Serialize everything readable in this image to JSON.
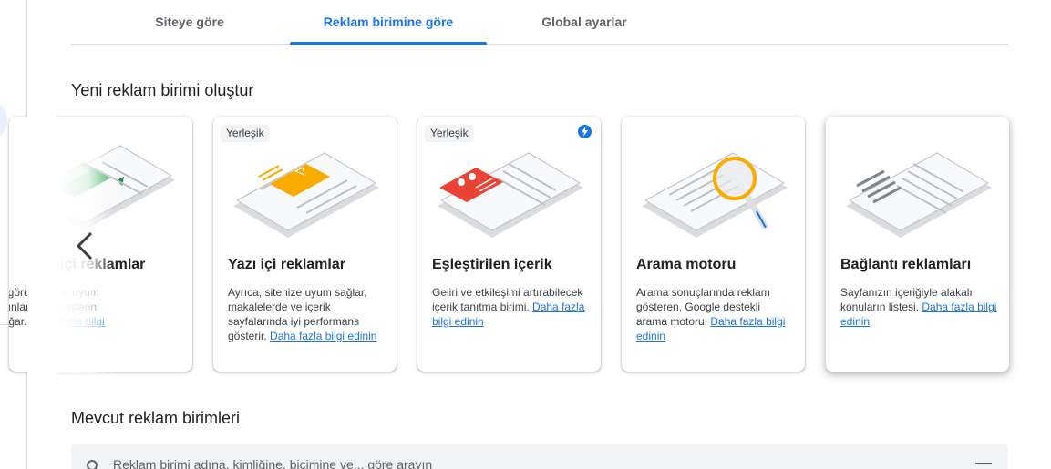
{
  "tabs": [
    {
      "label": "Siteye göre"
    },
    {
      "label": "Reklam birimine göre",
      "active": true
    },
    {
      "label": "Global ayarlar"
    }
  ],
  "section_new": "Yeni reklam birimi oluştur",
  "section_existing": "Mevcut reklam birimleri",
  "cards": [
    {
      "title": "içi reklamlar",
      "desc_lines": [
        "zin görünümüne uyum",
        "yayınların ve girişlerin",
        "a sığar."
      ],
      "link": "Daha fazla bilgi"
    },
    {
      "badge": "Yerleşik",
      "title": "Yazı içi reklamlar",
      "desc": "Ayrıca, sitenize uyum sağlar, makalelerde ve içerik sayfalarında iyi performans gösterir.",
      "link": "Daha fazla bilgi edinin"
    },
    {
      "badge": "Yerleşik",
      "title": "Eşleştirilen içerik",
      "desc": "Geliri ve etkileşimi artırabilecek içerik tanıtma birimi.",
      "link": "Daha fazla bilgi edinin",
      "icon": "lightning-icon"
    },
    {
      "title": "Arama motoru",
      "desc": "Arama sonuçlarında reklam gösteren, Google destekli arama motoru.",
      "link": "Daha fazla bilgi edinin"
    },
    {
      "title": "Bağlantı reklamları",
      "desc": "Sayfanızın içeriğiyle alakalı konuların listesi.",
      "link": "Daha fazla bilgi edinin"
    }
  ],
  "search": {
    "placeholder": "Reklam birimi adına, kimliğine, biçimine ve... göre arayın"
  },
  "colors": {
    "accent": "#1a73e8",
    "text": "#202124",
    "muted": "#5f6368",
    "illus_yellow": "#f9ab00",
    "illus_red": "#ea4335",
    "illus_green": "#34a853"
  }
}
